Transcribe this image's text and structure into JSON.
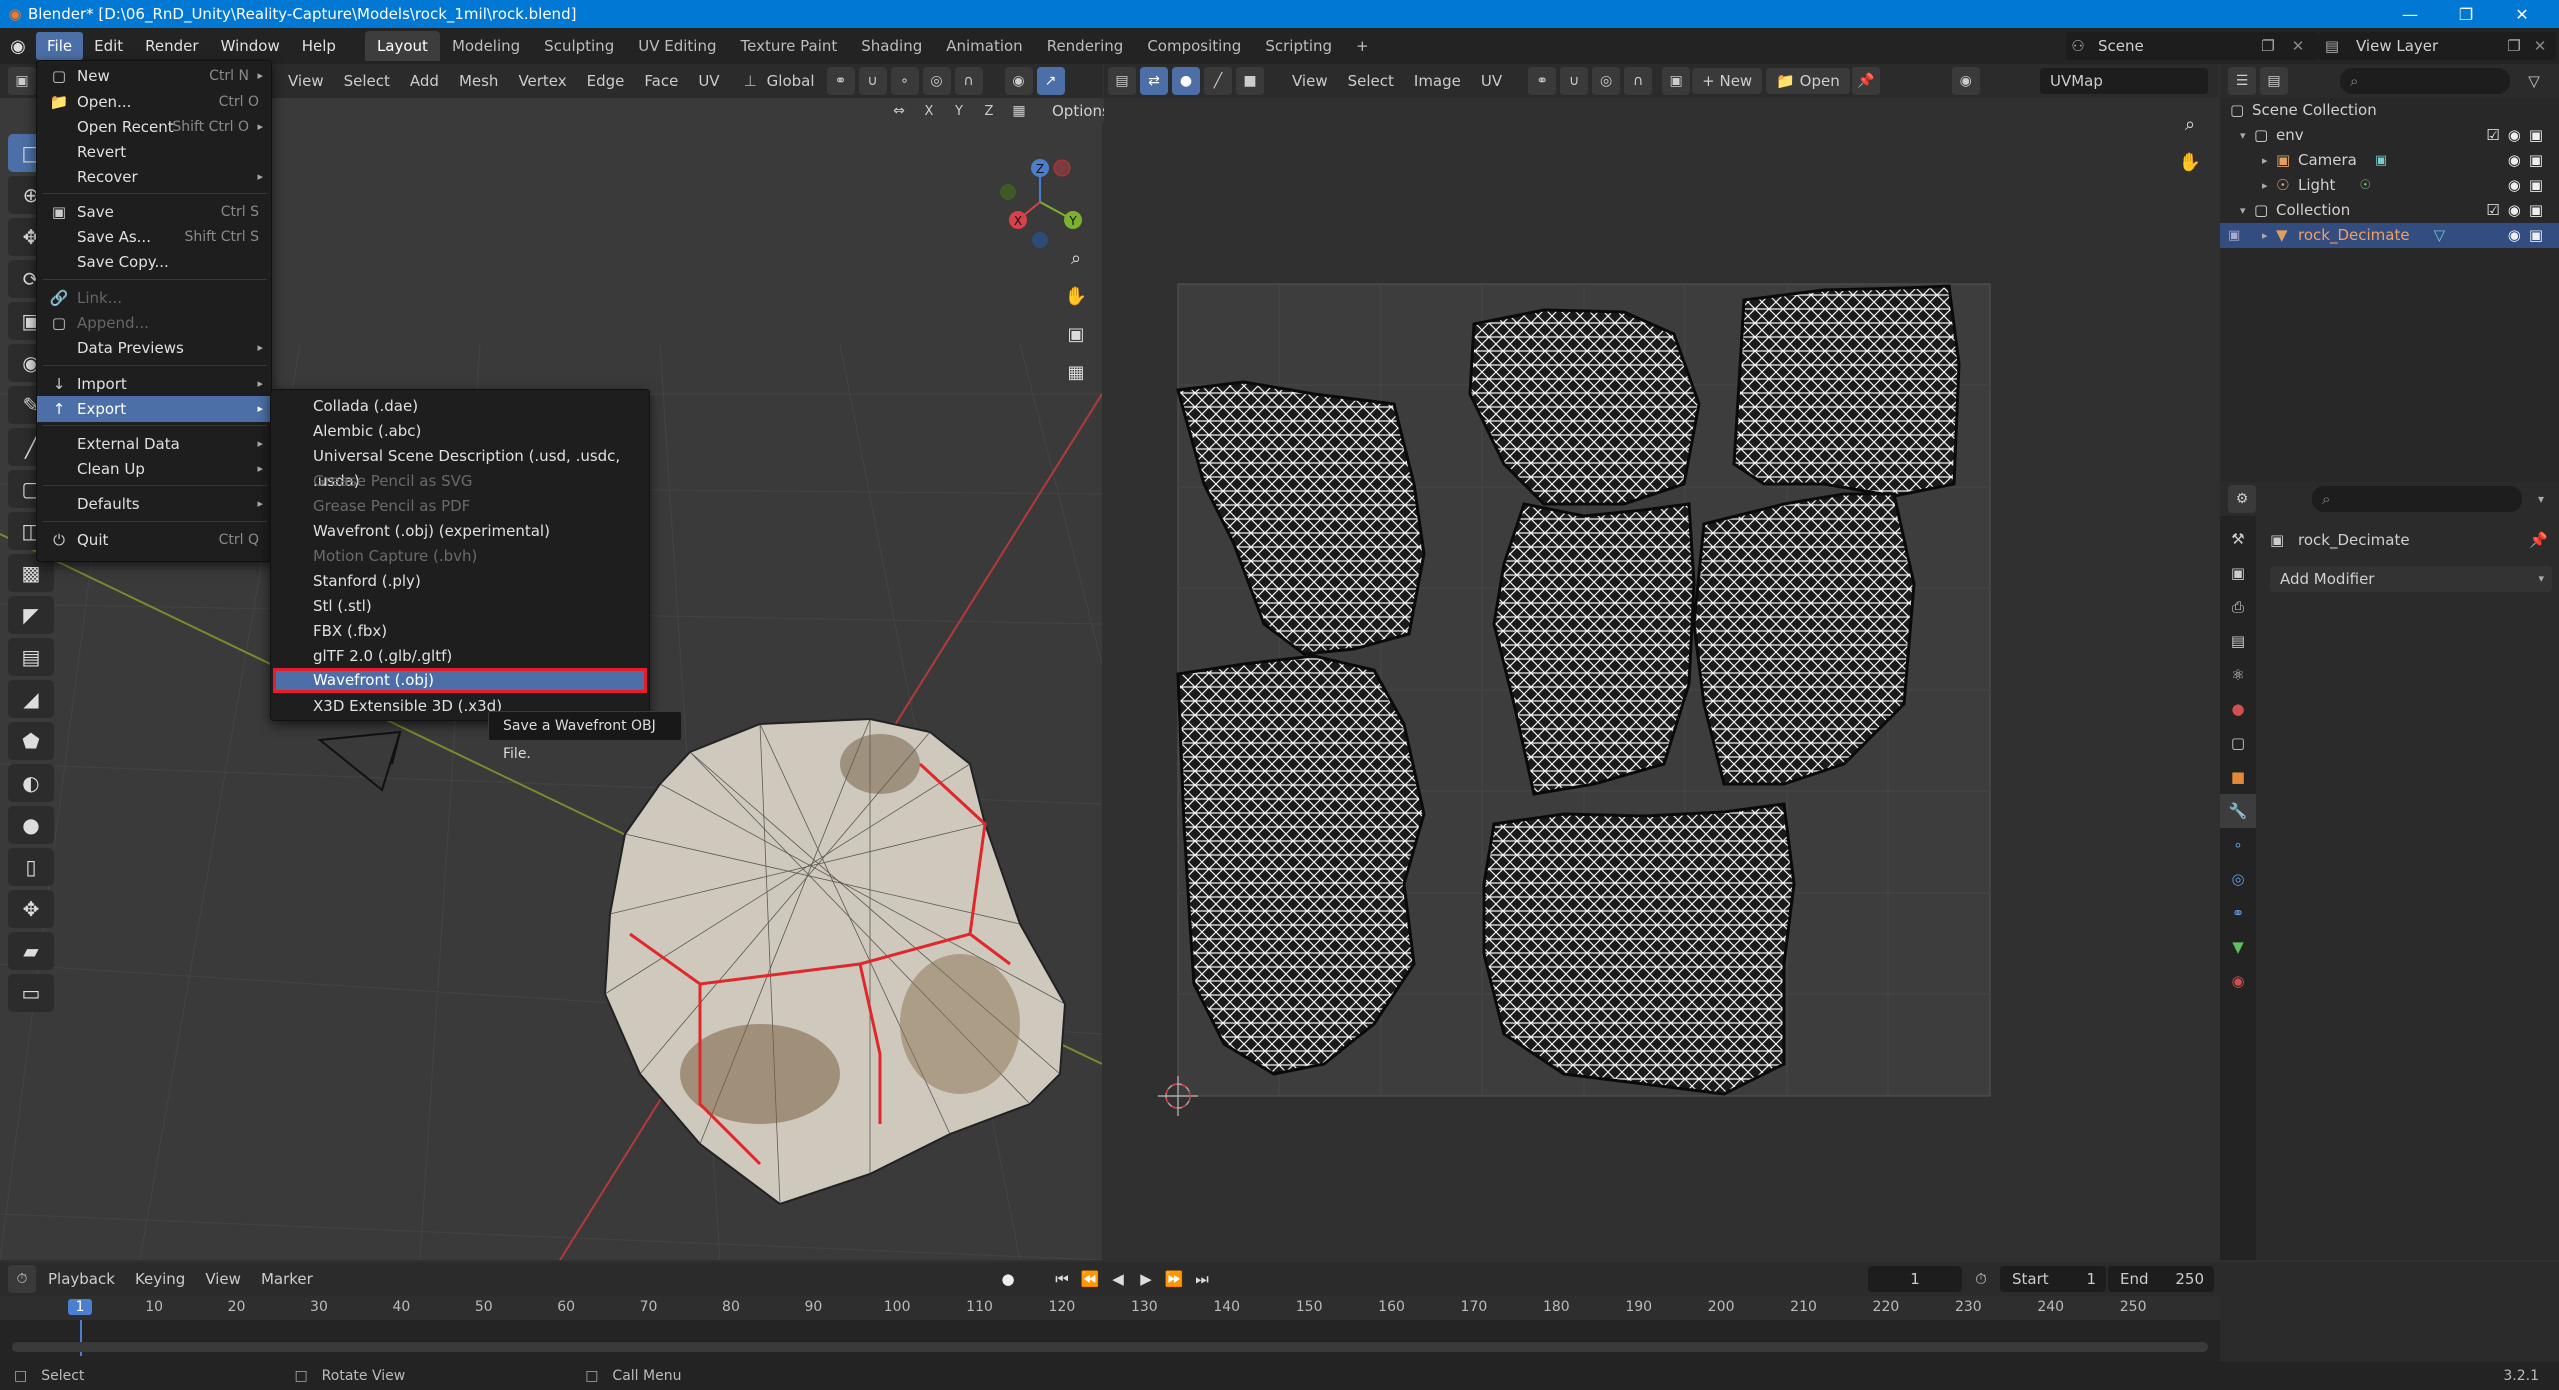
{
  "titlebar": {
    "title": "Blender* [D:\\06_RnD_Unity\\Reality-Capture\\Models\\rock_1mil\\rock.blend]"
  },
  "menubar": {
    "items": [
      "File",
      "Edit",
      "Render",
      "Window",
      "Help"
    ],
    "workspaces": [
      "Layout",
      "Modeling",
      "Sculpting",
      "UV Editing",
      "Texture Paint",
      "Shading",
      "Animation",
      "Rendering",
      "Compositing",
      "Scripting"
    ],
    "scene": "Scene",
    "view_layer": "View Layer"
  },
  "viewport_header": {
    "items": [
      "View",
      "Select",
      "Add",
      "Mesh",
      "Vertex",
      "Edge",
      "Face",
      "UV"
    ],
    "orientation": "Global",
    "axes": [
      "X",
      "Y",
      "Z"
    ],
    "options": "Options"
  },
  "uv_header": {
    "items": [
      "View",
      "Select",
      "Image",
      "UV"
    ],
    "new": "New",
    "open": "Open",
    "uvmap": "UVMap"
  },
  "file_menu": {
    "items": [
      {
        "label": "New",
        "shortcut": "Ctrl N",
        "submenu": true
      },
      {
        "label": "Open...",
        "shortcut": "Ctrl O"
      },
      {
        "label": "Open Recent",
        "shortcut": "Shift Ctrl O",
        "submenu": true
      },
      {
        "label": "Revert"
      },
      {
        "label": "Recover",
        "submenu": true
      },
      {
        "label": "Save",
        "shortcut": "Ctrl S"
      },
      {
        "label": "Save As...",
        "shortcut": "Shift Ctrl S"
      },
      {
        "label": "Save Copy..."
      },
      {
        "label": "Link...",
        "disabled": true
      },
      {
        "label": "Append...",
        "disabled": true
      },
      {
        "label": "Data Previews",
        "submenu": true
      },
      {
        "label": "Import",
        "submenu": true
      },
      {
        "label": "Export",
        "submenu": true,
        "highlighted": true
      },
      {
        "label": "External Data",
        "submenu": true
      },
      {
        "label": "Clean Up",
        "submenu": true
      },
      {
        "label": "Defaults",
        "submenu": true
      },
      {
        "label": "Quit",
        "shortcut": "Ctrl Q"
      }
    ]
  },
  "export_menu": {
    "items": [
      {
        "label": "Collada (.dae)"
      },
      {
        "label": "Alembic (.abc)"
      },
      {
        "label": "Universal Scene Description (.usd, .usdc, .usda)"
      },
      {
        "label": "Grease Pencil as SVG",
        "disabled": true
      },
      {
        "label": "Grease Pencil as PDF",
        "disabled": true
      },
      {
        "label": "Wavefront (.obj) (experimental)"
      },
      {
        "label": "Motion Capture (.bvh)",
        "disabled": true
      },
      {
        "label": "Stanford (.ply)"
      },
      {
        "label": "Stl (.stl)"
      },
      {
        "label": "FBX (.fbx)"
      },
      {
        "label": "glTF 2.0 (.glb/.gltf)"
      },
      {
        "label": "Wavefront (.obj)",
        "highlighted": true
      },
      {
        "label": "X3D Extensible 3D (.x3d)"
      }
    ],
    "tooltip": "Save a Wavefront OBJ File."
  },
  "outliner": {
    "root": "Scene Collection",
    "rows": [
      {
        "label": "env",
        "indent": 1,
        "type": "collection"
      },
      {
        "label": "Camera",
        "indent": 2,
        "type": "camera"
      },
      {
        "label": "Light",
        "indent": 2,
        "type": "light"
      },
      {
        "label": "Collection",
        "indent": 1,
        "type": "collection"
      },
      {
        "label": "rock_Decimate",
        "indent": 2,
        "type": "mesh",
        "selected": true
      }
    ]
  },
  "properties": {
    "object_name": "rock_Decimate",
    "add_modifier": "Add Modifier"
  },
  "timeline": {
    "menus": [
      "Playback",
      "Keying",
      "View",
      "Marker"
    ],
    "current_frame": "1",
    "start_label": "Start",
    "start": "1",
    "end_label": "End",
    "end": "250",
    "ticks": [
      "1",
      "10",
      "20",
      "30",
      "40",
      "50",
      "60",
      "70",
      "80",
      "90",
      "100",
      "110",
      "120",
      "130",
      "140",
      "150",
      "160",
      "170",
      "180",
      "190",
      "200",
      "210",
      "220",
      "230",
      "240",
      "250"
    ]
  },
  "statusbar": {
    "select": "Select",
    "rotate": "Rotate View",
    "call_menu": "Call Menu",
    "version": "3.2.1"
  }
}
